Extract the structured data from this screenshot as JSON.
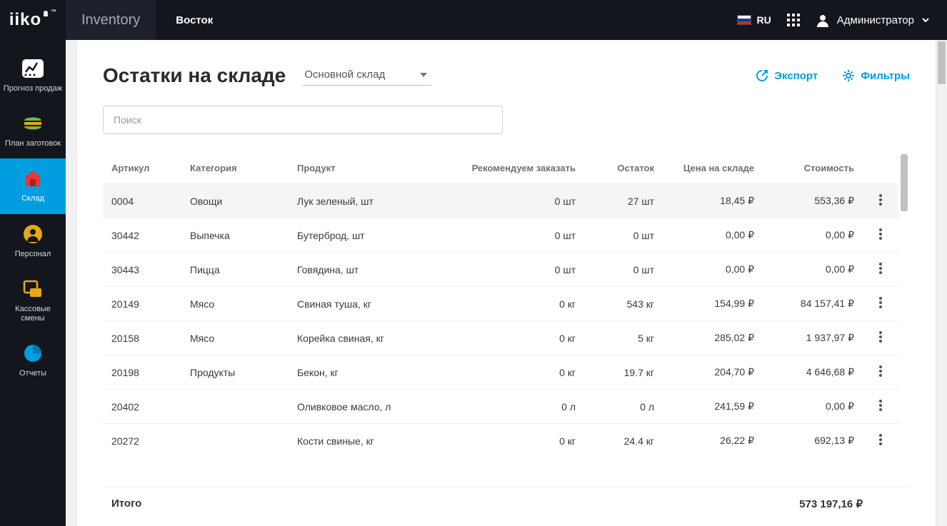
{
  "topbar": {
    "logo": "iiko",
    "app_name": "Inventory",
    "location": "Восток",
    "language": "RU",
    "user": "Администратор"
  },
  "sidebar": {
    "items": [
      {
        "id": "forecast",
        "label": "Прогноз продаж"
      },
      {
        "id": "prep",
        "label": "План заготовок"
      },
      {
        "id": "warehouse",
        "label": "Склад"
      },
      {
        "id": "personnel",
        "label": "Персонал"
      },
      {
        "id": "cash",
        "label": "Кассовые смены"
      },
      {
        "id": "reports",
        "label": "Отчеты"
      }
    ],
    "active": "warehouse"
  },
  "page": {
    "title": "Остатки на складе",
    "warehouse_selected": "Основной склад",
    "export_label": "Экспорт",
    "filters_label": "Фильтры",
    "search_placeholder": "Поиск"
  },
  "table": {
    "headers": {
      "article": "Артикул",
      "category": "Категория",
      "product": "Продукт",
      "recommend": "Рекомендуем заказать",
      "balance": "Остаток",
      "price": "Цена на складе",
      "cost": "Стоимость"
    },
    "rows": [
      {
        "article": "0004",
        "category": "Овощи",
        "product": "Лук зеленый, шт",
        "recommend": "0 шт",
        "balance": "27 шт",
        "price": "18,45 ₽",
        "cost": "553,36 ₽",
        "selected": true
      },
      {
        "article": "30442",
        "category": "Выпечка",
        "product": "Бутерброд, шт",
        "recommend": "0 шт",
        "balance": "0 шт",
        "price": "0,00 ₽",
        "cost": "0,00 ₽",
        "selected": false
      },
      {
        "article": "30443",
        "category": "Пицца",
        "product": "Говядина, шт",
        "recommend": "0 шт",
        "balance": "0 шт",
        "price": "0,00 ₽",
        "cost": "0,00 ₽",
        "selected": false
      },
      {
        "article": "20149",
        "category": "Мясо",
        "product": "Свиная туша, кг",
        "recommend": "0 кг",
        "balance": "543 кг",
        "price": "154,99 ₽",
        "cost": "84 157,41 ₽",
        "selected": false
      },
      {
        "article": "20158",
        "category": "Мясо",
        "product": "Корейка свиная, кг",
        "recommend": "0 кг",
        "balance": "5 кг",
        "price": "285,02 ₽",
        "cost": "1 937,97 ₽",
        "selected": false
      },
      {
        "article": "20198",
        "category": "Продукты",
        "product": "Бекон, кг",
        "recommend": "0 кг",
        "balance": "19.7 кг",
        "price": "204,70 ₽",
        "cost": "4 646,68 ₽",
        "selected": false
      },
      {
        "article": "20402",
        "category": "",
        "product": "Оливковое масло, л",
        "recommend": "0 л",
        "balance": "0 л",
        "price": "241,59 ₽",
        "cost": "0,00 ₽",
        "selected": false
      },
      {
        "article": "20272",
        "category": "",
        "product": "Кости свиные, кг",
        "recommend": "0 кг",
        "balance": "24.4 кг",
        "price": "26,22 ₽",
        "cost": "692,13 ₽",
        "selected": false
      }
    ],
    "footer": {
      "total_label": "Итого",
      "total_value": "573 197,16 ₽"
    }
  }
}
